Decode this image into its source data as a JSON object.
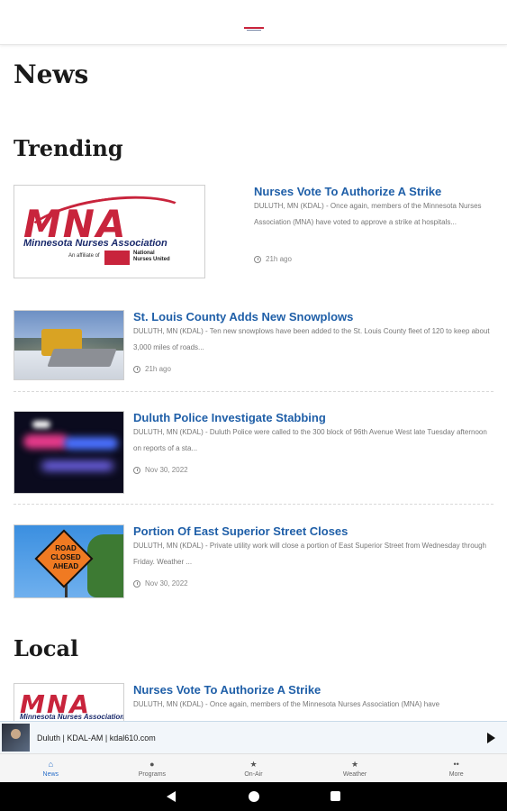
{
  "page": {
    "title": "News",
    "sections": {
      "trending": "Trending",
      "local": "Local"
    }
  },
  "trending": [
    {
      "title": "Nurses Vote To Authorize A Strike",
      "snippet": "DULUTH, MN (KDAL) - Once again, members of the Minnesota Nurses Association (MNA) have voted to approve a strike at hospitals...",
      "time": "21h ago",
      "image": "mna-logo"
    },
    {
      "title": "St. Louis County Adds New Snowplows",
      "snippet": "DULUTH, MN (KDAL) - Ten new snowplows have been added to the St. Louis County fleet of 120 to keep about 3,000 miles of roads...",
      "time": "21h ago",
      "image": "snowplow-photo"
    },
    {
      "title": "Duluth Police Investigate Stabbing",
      "snippet": "DULUTH, MN (KDAL) - Duluth Police were called to the 300 block of 96th Avenue West late Tuesday afternoon on reports of a sta...",
      "time": "Nov 30, 2022",
      "image": "police-lights-photo"
    },
    {
      "title": "Portion Of East Superior Street Closes",
      "snippet": "DULUTH, MN (KDAL) - Private utility work will close a portion of East Superior Street from Wednesday through Friday. Weather ...",
      "time": "Nov 30, 2022",
      "image": "road-closed-photo"
    }
  ],
  "local": [
    {
      "title": "Nurses Vote To Authorize A Strike",
      "snippet": "DULUTH, MN (KDAL) - Once again, members of the Minnesota Nurses Association (MNA) have",
      "image": "mna-logo"
    }
  ],
  "mna_logo": {
    "letters": "MNA",
    "name": "Minnesota Nurses Association",
    "affiliation": "An affiliate of",
    "union": "National Nurses United"
  },
  "road_sign": {
    "text": "ROAD CLOSED AHEAD"
  },
  "player": {
    "station": "Duluth | KDAL-AM | kdal610.com",
    "play_icon": "play-icon"
  },
  "tabs": [
    {
      "label": "News",
      "icon": "home-icon",
      "active": true
    },
    {
      "label": "Programs",
      "icon": "mic-icon",
      "active": false
    },
    {
      "label": "On-Air",
      "icon": "star-icon",
      "active": false
    },
    {
      "label": "Weather",
      "icon": "star-icon",
      "active": false
    },
    {
      "label": "More",
      "icon": "more-icon",
      "active": false
    }
  ],
  "colors": {
    "link": "#1f5fa8",
    "brand_red": "#c8243c",
    "active_tab": "#2a6fc9"
  }
}
